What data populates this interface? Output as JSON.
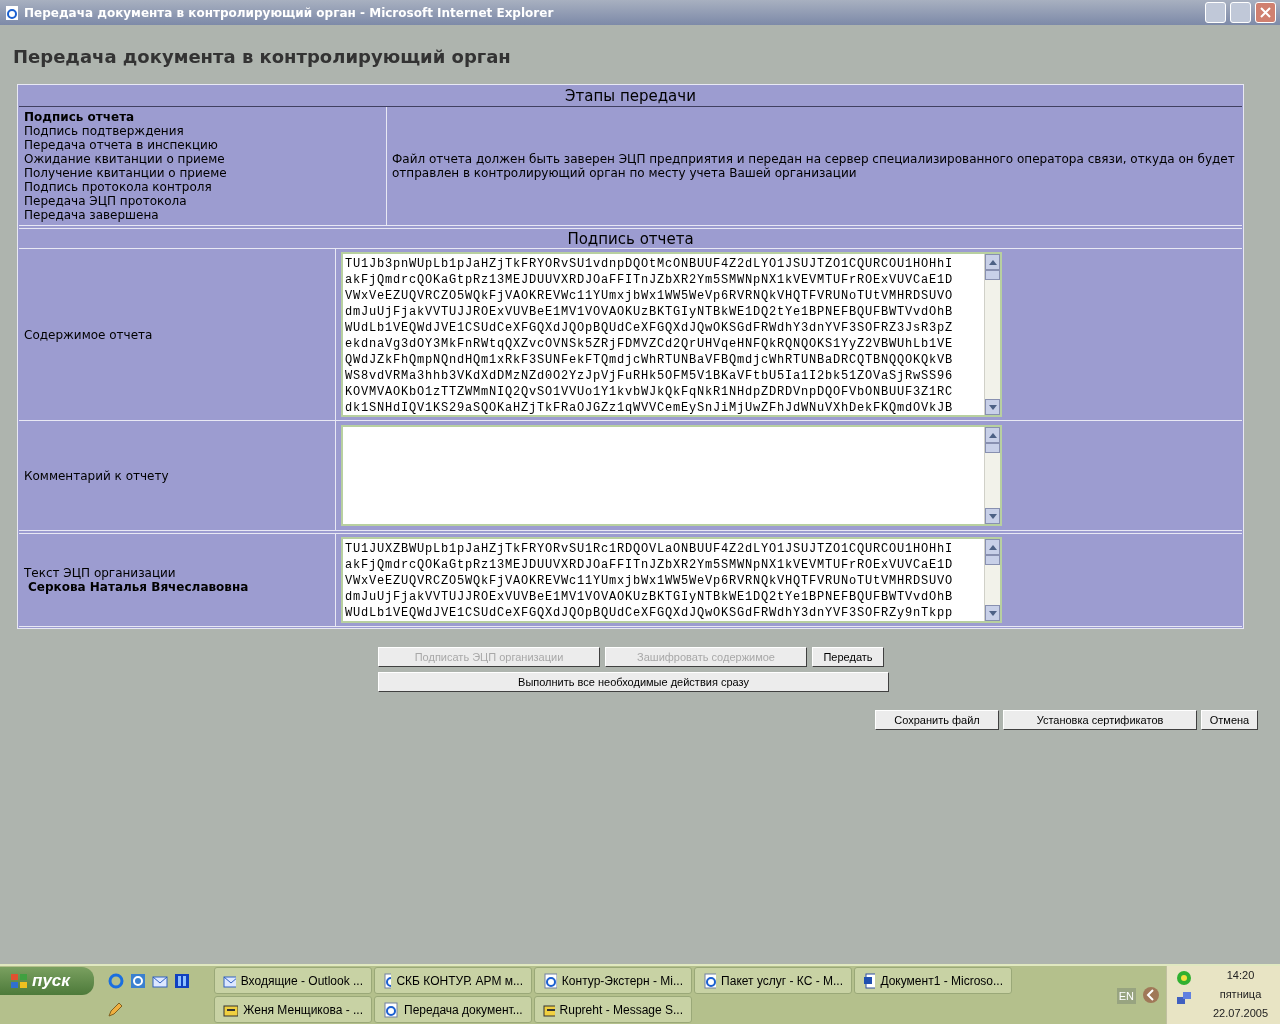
{
  "window": {
    "title": "Передача документа в контролирующий орган - Microsoft Internet Explorer"
  },
  "page_title": "Передача документа в контролирующий орган",
  "stages": {
    "heading": "Этапы передачи",
    "items": [
      {
        "label": "Подпись отчета",
        "selected": true
      },
      {
        "label": "Подпись подтверждения",
        "selected": false
      },
      {
        "label": "Передача отчета в инспекцию",
        "selected": false
      },
      {
        "label": "Ожидание квитанции о приеме",
        "selected": false
      },
      {
        "label": "Получение квитанции о приеме",
        "selected": false
      },
      {
        "label": "Подпись протокола контроля",
        "selected": false
      },
      {
        "label": "Передача ЭЦП протокола",
        "selected": false
      },
      {
        "label": "Передача завершена",
        "selected": false
      }
    ],
    "description": "Файл отчета должен быть заверен ЭЦП предприятия и передан на сервер специализированного оператора связи, откуда он будет отправлен в контролирующий орган по месту учета Вашей организации"
  },
  "section": {
    "heading": "Подпись отчета",
    "rows": [
      {
        "label": "Содержимое отчета",
        "lines": [
          "TU1Jb3pnWUpLb1pJaHZjTkFRYORvSU1vdnpDQOtMcONBUUF4Z2dLYO1JSUJTZO1CQURCOU1HOHhI",
          "akFjQmdrcQOKaGtpRz13MEJDUUVXRDJOaFFITnJZbXR2Ym5SMWNpNX1kVEVMTUFrROExVUVCaE1D",
          "VWxVeEZUQVRCZO5WQkFjVAOKREVWc11YUmxjbWx1WW5WeVp6RVRNQkVHQTFVRUNoTUtVMHRDSUVO",
          "dmJuUjFjakVVTUJJROExVUVBeE1MV1VOVAOKUzBKTGIyNTBkWE1DQ2tYe1BPNEFBQUFBWTVvdOhB",
          "WUdLb1VEQWdJVE1CSUdCeXFGQXdJQOpBQUdCeXFGQXdJQwOKSGdFRWdhY3dnYVF3SOFRZ3JsR3pZ",
          "ekdnaVg3dOY3MkFnRWtqQXZvcOVNSk5ZRjFDMVZCd2QrUHVqeHNFQkRQNQOKS1YyZ2VBWUhLb1VE",
          "QWdJZkFhQmpNQndHQm1xRkF3SUNFekFTQmdjcWhRTUNBaVFBQmdjcWhRTUNBaDRCQTBNQQOKQkVB",
          "WS8vdVRMa3hhb3VKdXdDMzNZd0O2YzJpVjFuRHk5OFM5V1BKaVFtbU5Ia1I2bk51ZOVaSjRwSS96",
          "KOVMVAOKbO1zTTZWMmNIQ2QvSO1VVUo1Y1kvbWJkQkFqNkR1NHdpZDRDVnpDQOFVbONBUUF3Z1RC",
          "dk1SNHdIQV1KS29aSQOKaHZjTkFRaOJGZz1qWVVCemEySnJiMjUwZFhJdWNuVXhDekFKQmdOVkJB"
        ],
        "kind": "text"
      },
      {
        "label": "Комментарий к отчету",
        "lines": [],
        "kind": "input"
      },
      {
        "label": "Текст ЭЦП организации",
        "signer": "Серкова Наталья Вячеславовна",
        "lines": [
          "TU1JUXZBWUpLb1pJaHZjTkFRYORvSU1Rc1RDQOVLaONBUUF4Z2dLYO1JSUJTZO1CQURCOU1HOHhI",
          "akFjQmdrcQOKaGtpRz13MEJDUUVXRDJOaFFITnJZbXR2Ym5SMWNpNX1kVEVMTUFrROExVUVCaE1D",
          "VWxVeEZUQVRCZO5WQkFjVAOKREVWc11YUmxjbWx1WW5WeVp6RVRNQkVHQTFVRUNoTUtVMHRDSUVO",
          "dmJuUjFjakVVTUJJROExVUVBeE1MV1VOVAOKUzBKTGIyNTBkWE1DQ2tYe1BPNEFBQUFBWTVvdOhB",
          "WUdLb1VEQWdJVE1CSUdCeXFGQXdJQOpBQUdCeXFGQXdJQwOKSGdFRWdhY3dnYVF3SOFRZy9nTkpp"
        ],
        "kind": "text"
      }
    ]
  },
  "actions": [
    {
      "label": "Подписать ЭЦП организации",
      "disabled": true
    },
    {
      "label": "Зашифровать содержимое",
      "disabled": true
    },
    {
      "label": "Передать",
      "disabled": false
    }
  ],
  "do_all": {
    "label": "Выполнить все необходимые действия сразу"
  },
  "footer_buttons": [
    "Сохранить файл",
    "Установка сертификатов",
    "Отмена"
  ],
  "taskbar": {
    "start": "пуск",
    "rows": [
      [
        {
          "label": "Входящие - Outlook ...",
          "kind": "mail"
        },
        {
          "label": "СКБ КОНТУР. АРМ м...",
          "kind": "ie"
        },
        {
          "label": "Контур-Экстерн - Mi...",
          "kind": "ie"
        },
        {
          "label": "Пакет услуг - КС - М...",
          "kind": "ie"
        },
        {
          "label": "Документ1 - Microso...",
          "kind": "word"
        }
      ],
      [
        {
          "label": "Женя Менщикова - ...",
          "kind": "chat"
        },
        {
          "label": "Передача документ...",
          "kind": "ie"
        },
        {
          "label": "Rupreht - Message S...",
          "kind": "chat"
        }
      ]
    ],
    "language": "EN",
    "time": "14:20",
    "weekday": "пятница",
    "date": "22.07.2005"
  }
}
